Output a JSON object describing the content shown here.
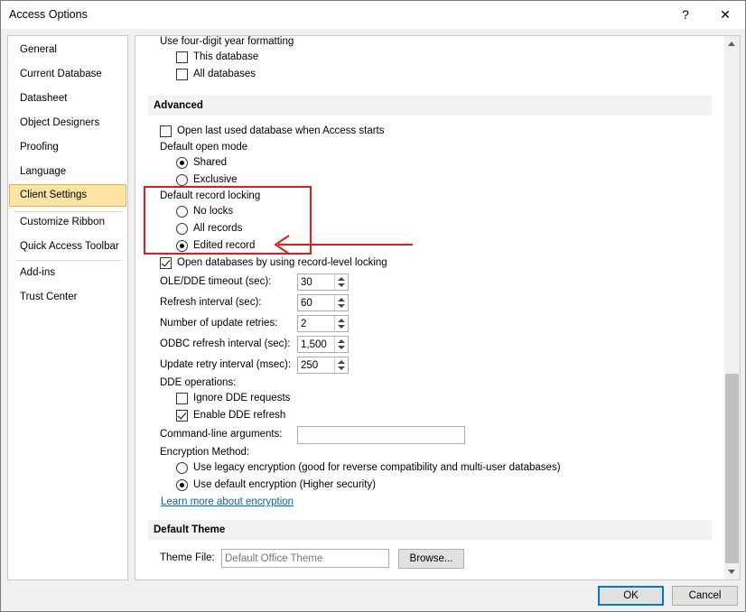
{
  "window": {
    "title": "Access Options",
    "help_glyph": "?",
    "close_glyph": "✕"
  },
  "sidebar": {
    "items": [
      {
        "label": "General"
      },
      {
        "label": "Current Database"
      },
      {
        "label": "Datasheet"
      },
      {
        "label": "Object Designers"
      },
      {
        "label": "Proofing"
      },
      {
        "label": "Language"
      },
      {
        "label": "Client Settings",
        "selected": true
      },
      {
        "label": "Customize Ribbon"
      },
      {
        "label": "Quick Access Toolbar"
      },
      {
        "label": "Add-ins"
      },
      {
        "label": "Trust Center"
      }
    ]
  },
  "main": {
    "year_format": {
      "label": "Use four-digit year formatting",
      "this_database": "This database",
      "all_databases": "All databases"
    },
    "advanced": {
      "header": "Advanced",
      "open_last": "Open last used database when Access starts",
      "open_mode_label": "Default open mode",
      "open_mode_options": [
        "Shared",
        "Exclusive"
      ],
      "open_mode_selected": "Shared",
      "record_locking_label": "Default record locking",
      "record_locking_options": [
        "No locks",
        "All records",
        "Edited record"
      ],
      "record_locking_selected": "Edited record",
      "record_level": "Open databases by using record-level locking",
      "spinners": [
        {
          "label": "OLE/DDE timeout (sec):",
          "value": "30"
        },
        {
          "label": "Refresh interval (sec):",
          "value": "60"
        },
        {
          "label": "Number of update retries:",
          "value": "2"
        },
        {
          "label": "ODBC refresh interval (sec):",
          "value": "1,500"
        },
        {
          "label": "Update retry interval (msec):",
          "value": "250"
        }
      ],
      "dde_label": "DDE operations:",
      "ignore_dde": "Ignore DDE requests",
      "enable_dde": "Enable DDE refresh",
      "cmdline_label": "Command-line arguments:",
      "cmdline_value": "",
      "encryption_label": "Encryption Method:",
      "encryption_options": [
        "Use legacy encryption (good for reverse compatibility and multi-user databases)",
        "Use default encryption (Higher security)"
      ],
      "encryption_selected": 1,
      "learn_more": "Learn more about encryption"
    },
    "default_theme": {
      "header": "Default Theme",
      "theme_file_label": "Theme File:",
      "theme_file_placeholder": "Default Office Theme",
      "browse": "Browse..."
    }
  },
  "footer": {
    "ok": "OK",
    "cancel": "Cancel"
  },
  "annotation": {
    "color": "#e01b1b"
  }
}
